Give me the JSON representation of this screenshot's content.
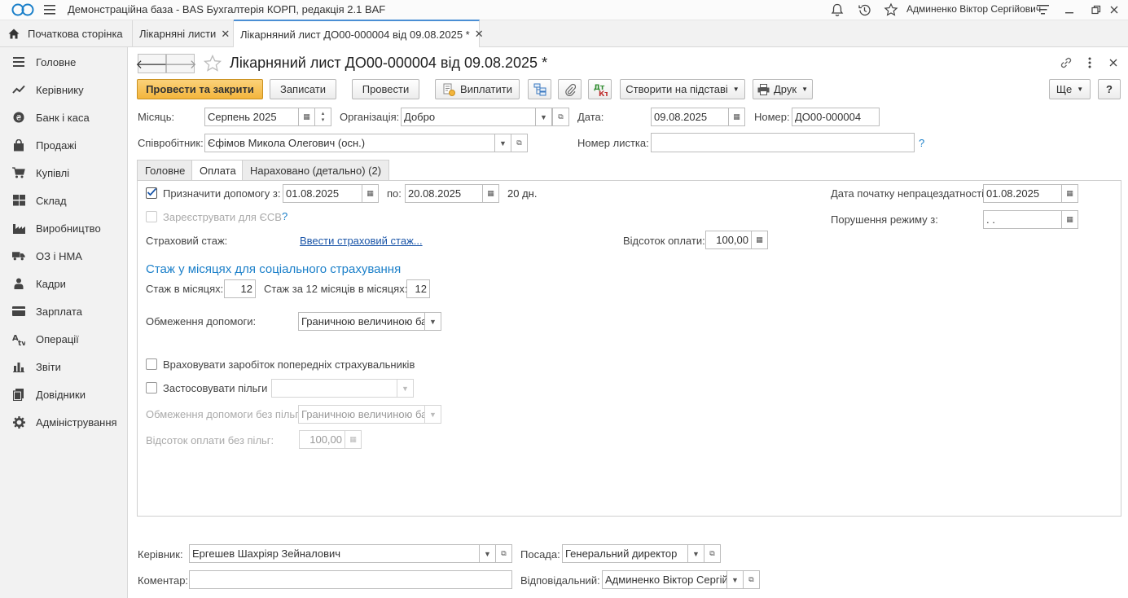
{
  "titlebar": {
    "app_title": "Демонстраційна база - BAS Бухгалтерія КОРП, редакція 2.1 BAF",
    "user_name": "Админенко Віктор Сергійович"
  },
  "window_tabs": [
    {
      "label": "Початкова сторінка"
    },
    {
      "label": "Лікарняні листи"
    },
    {
      "label": "Лікарняний лист ДО00-000004 від 09.08.2025 *"
    }
  ],
  "sidebar": {
    "items": [
      {
        "label": "Головне",
        "icon": "menu-icon"
      },
      {
        "label": "Керівнику",
        "icon": "trend-icon"
      },
      {
        "label": "Банк і каса",
        "icon": "coin-icon"
      },
      {
        "label": "Продажі",
        "icon": "bag-icon"
      },
      {
        "label": "Купівлі",
        "icon": "cart-icon"
      },
      {
        "label": "Склад",
        "icon": "warehouse-icon"
      },
      {
        "label": "Виробництво",
        "icon": "factory-icon"
      },
      {
        "label": "ОЗ і НМА",
        "icon": "truck-icon"
      },
      {
        "label": "Кадри",
        "icon": "person-icon"
      },
      {
        "label": "Зарплата",
        "icon": "wallet-icon"
      },
      {
        "label": "Операції",
        "icon": "operations-icon"
      },
      {
        "label": "Звіти",
        "icon": "bar-chart-icon"
      },
      {
        "label": "Довідники",
        "icon": "books-icon"
      },
      {
        "label": "Адміністрування",
        "icon": "gear-icon"
      }
    ]
  },
  "form": {
    "title": "Лікарняний лист ДО00-000004 від 09.08.2025 *"
  },
  "toolbar": {
    "post_and_close": "Провести та закрити",
    "save": "Записати",
    "post": "Провести",
    "pay": "Виплатити",
    "create_based": "Створити на підставі",
    "print": "Друк",
    "more": "Ще",
    "help": "?"
  },
  "header_fields": {
    "month_label": "Місяць:",
    "month_value": "Серпень 2025",
    "org_label": "Організація:",
    "org_value": "Добро",
    "date_label": "Дата:",
    "date_value": "09.08.2025",
    "number_label": "Номер:",
    "number_value": "ДО00-000004",
    "employee_label": "Співробітник:",
    "employee_value": "Єфімов Микола Олегович (осн.)",
    "sheet_number_label": "Номер листка:",
    "sheet_number_value": "",
    "sheet_help": "?"
  },
  "inner_tabs": [
    {
      "label": "Головне"
    },
    {
      "label": "Оплата"
    },
    {
      "label": "Нараховано (детально) (2)"
    }
  ],
  "payment": {
    "assign_label": "Призначити допомогу з:",
    "assign_from": "01.08.2025",
    "to_label": "по:",
    "assign_to": "20.08.2025",
    "days": "20 дн.",
    "register_esv_label": "Зареєструвати для ЄСВ",
    "register_help": "?",
    "insurance_label": "Страховий стаж:",
    "insurance_link": "Ввести страховий стаж...",
    "percent_label": "Відсоток оплати:",
    "percent_value": "100,00",
    "incapacity_label": "Дата початку непрацездатності:",
    "incapacity_value": "01.08.2025",
    "violation_label": "Порушення режиму з:",
    "violation_value": " .  .",
    "section_title": "Стаж у місяцях для соціального страхування",
    "months_label": "Стаж в місяцях:",
    "months_value": "12",
    "months12_label": "Стаж за 12 місяців в місяцях:",
    "months12_value": "12",
    "limit_label": "Обмеження допомоги:",
    "limit_value": "Граничною величиною ба",
    "prev_insurers_label": "Враховувати заробіток попередніх страхувальників",
    "benefits_label": "Застосовувати пільги",
    "benefits_value": "",
    "limit_nobenefit_label": "Обмеження допомоги без пільг:",
    "limit_nobenefit_value": "Граничною величиною ба",
    "percent_nobenefit_label": "Відсоток оплати без пільг:",
    "percent_nobenefit_value": "100,00"
  },
  "footer": {
    "manager_label": "Керівник:",
    "manager_value": "Ергешев Шахріяр Зейналович",
    "position_label": "Посада:",
    "position_value": "Генеральний директор",
    "comment_label": "Коментар:",
    "comment_value": "",
    "responsible_label": "Відповідальний:",
    "responsible_value": "Админенко Віктор Сергійо"
  },
  "colors": {
    "primary_button": "#f3b53c",
    "accent_blue": "#1a7fc9",
    "link": "#1a55a8"
  }
}
